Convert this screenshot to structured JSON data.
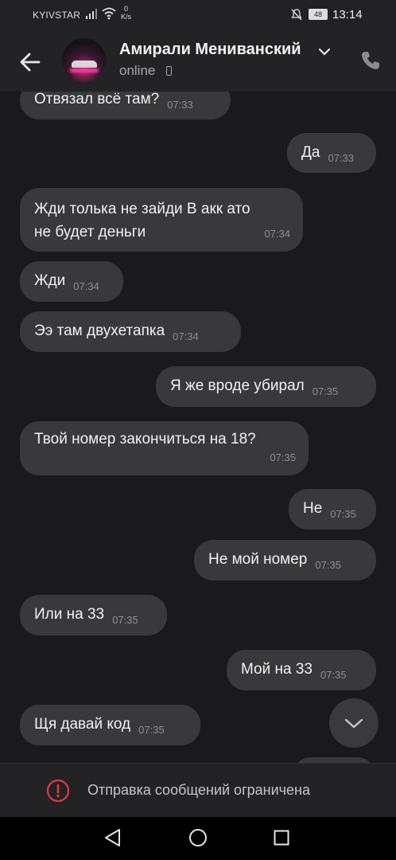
{
  "status_bar": {
    "carrier": "KYIVSTAR",
    "speed_value": "0",
    "speed_unit": "K/s",
    "battery": "48",
    "time": "13:14"
  },
  "header": {
    "name": "Амирали Мениванский",
    "status": "online"
  },
  "messages": [
    {
      "side": "in",
      "text": "Отвязал всё там?",
      "time": "07:33"
    },
    {
      "side": "out",
      "text": "Да",
      "time": "07:33"
    },
    {
      "side": "in",
      "text": "Жди толька не зайди В акк ато\nне будет деньги",
      "time": "07:34"
    },
    {
      "side": "in",
      "text": "Жди",
      "time": "07:34"
    },
    {
      "side": "in",
      "text": "Ээ там двухетапка",
      "time": "07:34"
    },
    {
      "side": "out",
      "text": "Я же вроде убирал",
      "time": "07:35"
    },
    {
      "side": "in",
      "text": "Твой номер закончиться на 18?",
      "time": "07:35"
    },
    {
      "side": "out",
      "text": "Не",
      "time": "07:35"
    },
    {
      "side": "out",
      "text": "Не мой номер",
      "time": "07:35"
    },
    {
      "side": "in",
      "text": "Или на 33",
      "time": "07:35"
    },
    {
      "side": "out",
      "text": "Мой на 33",
      "time": "07:35"
    },
    {
      "side": "in",
      "text": "Щя давай код",
      "time": "07:35"
    }
  ],
  "footer": {
    "restricted_text": "Отправка сообщений ограничена"
  },
  "colors": {
    "background": "#1a1a1c",
    "bubble": "#39393c",
    "warning": "#e23a3a"
  }
}
